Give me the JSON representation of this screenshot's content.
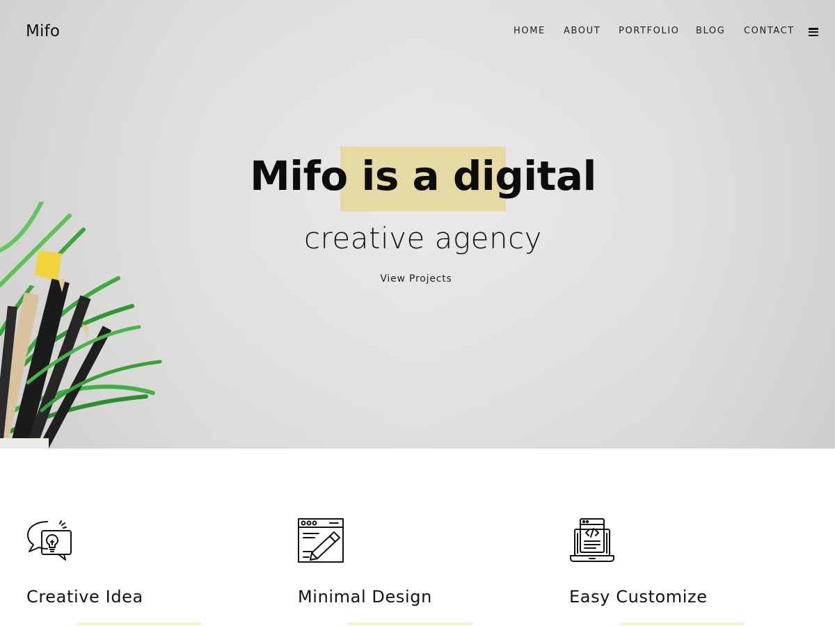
{
  "header": {
    "brand": "Mifo",
    "nav": [
      {
        "label": "HOME",
        "active": true
      },
      {
        "label": "ABOUT",
        "active": false
      },
      {
        "label": "PORTFOLIO",
        "active": false
      },
      {
        "label": "BLOG",
        "active": false
      },
      {
        "label": "CONTACT",
        "active": false
      }
    ],
    "menu_icon": "hamburger-menu-icon"
  },
  "hero": {
    "headline": "Mifo is a digital",
    "subheadline": "creative agency",
    "cta_label": "View Projects",
    "image": "pencils-and-plant-pot",
    "highlight_color": "#e6d9a4"
  },
  "features": [
    {
      "icon": "idea-chat-bubbles-icon",
      "title": "Creative Idea"
    },
    {
      "icon": "browser-pencil-icon",
      "title": "Minimal Design"
    },
    {
      "icon": "laptop-code-icon",
      "title": "Easy Customize"
    }
  ],
  "colors": {
    "accent": "#f3e2a3",
    "text": "#111111",
    "feature_underline": "#fbefc8"
  }
}
